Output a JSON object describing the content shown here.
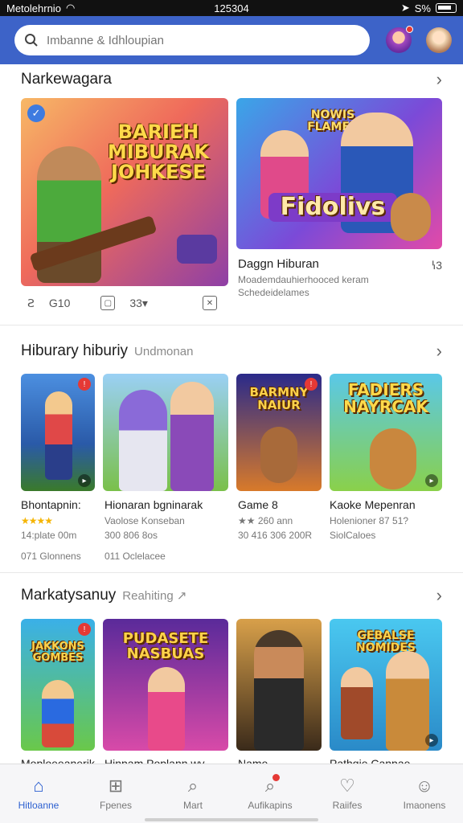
{
  "status": {
    "carrier": "Metolehrnio",
    "time": "125304",
    "battery": "S%"
  },
  "search": {
    "placeholder": "Imbanne & Idhloupian"
  },
  "section1": {
    "title": "Narkewagara",
    "cards": [
      {
        "art": "BARIEH MIBURAK JOHKESE",
        "title": "",
        "sub": ""
      },
      {
        "art": "Fidolivs",
        "art_top": "NOWIS FLAMER",
        "title": "Daggn Hiburan",
        "rating": "ꝇ3",
        "sub1": "Moademdauhierhooced keram",
        "sub2": "Schedeidelames"
      }
    ],
    "meta": [
      "Ꙅ",
      "G10",
      "⊡",
      "33▾",
      "⊠"
    ]
  },
  "section2": {
    "title": "Hiburary hiburiy",
    "sub": "Undmonan",
    "cards": [
      {
        "title": "Bhontapnin:",
        "line1": "★★★★",
        "line2": "14:plate 00m",
        "line3": "071 Glonnens"
      },
      {
        "title": "Hionaran bgninarak",
        "line1": "Vaolose Konseban",
        "line2": "300 806 8os",
        "line3": "011 Oclelacee"
      },
      {
        "title": "Game 8",
        "line1": "★★ 260 ann",
        "line2": "30 416 306 200R",
        "line3": ""
      },
      {
        "title": "Kaoke Mepenran",
        "line1": "Holenioner 87 51?",
        "line2": "SiolCaloes",
        "line3": ""
      }
    ],
    "arts": [
      "",
      "",
      "BARMNY NAIUR",
      "FADIERS NAYRCAK"
    ]
  },
  "section3": {
    "title": "Markatysanuy",
    "sub": "Reahiting ↗",
    "cards": [
      {
        "title": "Moploeeanerik",
        "art": "JAKKONS GOMBES"
      },
      {
        "title": "Hinpam Poplann wy",
        "art": "PUDASETE NASBUAS"
      },
      {
        "title": "Name",
        "art": ""
      },
      {
        "title": "Pathgie Canpae",
        "art": "GEBALSE NOMIDES"
      }
    ]
  },
  "nav": [
    {
      "label": "Hitloanne",
      "icon": "⌂"
    },
    {
      "label": "Fpenes",
      "icon": "⊞"
    },
    {
      "label": "Mart",
      "icon": "⌕"
    },
    {
      "label": "Aufikapins",
      "icon": "⌕"
    },
    {
      "label": "Raiifes",
      "icon": "♡"
    },
    {
      "label": "Imaonens",
      "icon": "☺"
    }
  ],
  "colors": {
    "header": "#3d63c8",
    "active": "#2b5fd0",
    "stars": "#f5b400"
  }
}
